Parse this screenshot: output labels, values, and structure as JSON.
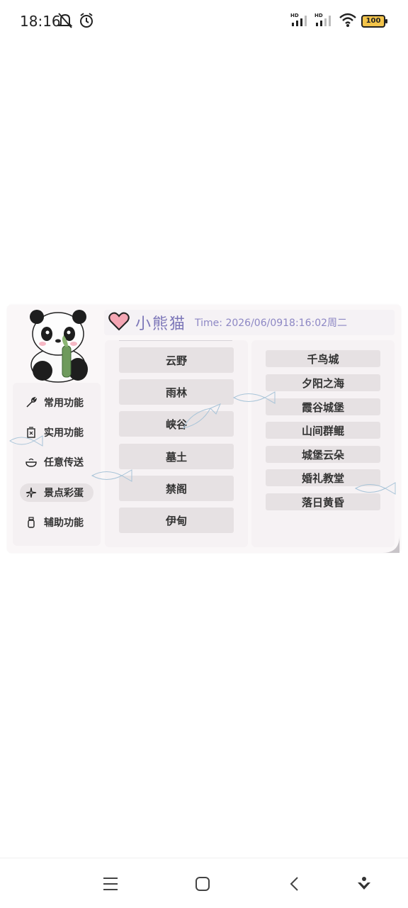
{
  "status_bar": {
    "time": "18:16",
    "battery": "100",
    "icons": [
      "mute-icon",
      "alarm-icon",
      "hd-signal-icon",
      "hd-signal-icon",
      "wifi-icon",
      "battery-icon"
    ]
  },
  "header": {
    "title": "小熊猫",
    "time": "Time:  2026/06/0918:16:02周二"
  },
  "sidebar": {
    "items": [
      {
        "label": "常用功能",
        "icon": "wrench-icon"
      },
      {
        "label": "实用功能",
        "icon": "tag-icon"
      },
      {
        "label": "任意传送",
        "icon": "bowl-icon"
      },
      {
        "label": "景点彩蛋",
        "icon": "sparkle-icon",
        "active": true
      },
      {
        "label": "辅助功能",
        "icon": "jar-icon"
      }
    ]
  },
  "middle_list": [
    "云野",
    "雨林",
    "峡谷",
    "墓土",
    "禁阁",
    "伊甸"
  ],
  "right_list": [
    "千鸟城",
    "夕阳之海",
    "霞谷城堡",
    "山间群鲲",
    "城堡云朵",
    "婚礼教堂",
    "落日黄昏"
  ],
  "colors": {
    "accent_text": "#7c76b8",
    "button_bg": "#e6e1e3",
    "panel_bg": "#faf7f8",
    "heart": "#f4a6b4"
  },
  "nav_bar": {
    "icons": [
      "menu-icon",
      "home-icon",
      "back-icon",
      "assistant-icon"
    ]
  }
}
